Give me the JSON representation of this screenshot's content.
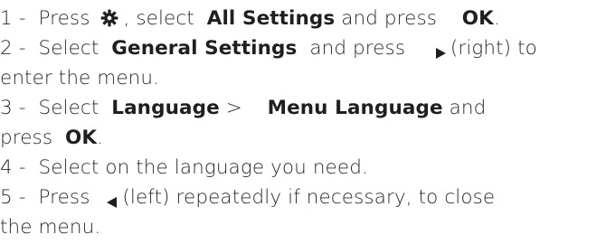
{
  "steps": [
    {
      "n": "1 -",
      "press": "Press",
      "icon": "gear-icon",
      "after_icon": ", select",
      "bold1": "All Settings",
      "and_press": "and press",
      "bold2": "OK",
      "end": "."
    },
    {
      "n": "2 -",
      "select": "Select",
      "bold1": "General Settings",
      "and_press": "and press",
      "icon": "triangle-right-icon",
      "after_icon": "(right) to",
      "cont": "enter the menu."
    },
    {
      "n": "3 -",
      "select": "Select",
      "bold1": "Language",
      "sep": ">",
      "bold2": "Menu Language",
      "and": "and",
      "press": "press",
      "bold3": "OK",
      "end": "."
    },
    {
      "n": "4 -",
      "text": "Select on the language you need."
    },
    {
      "n": "5 -",
      "press": "Press",
      "icon": "triangle-left-icon",
      "after_icon": "(left) repeatedly if necessary, to close",
      "cont": "the menu."
    }
  ],
  "colors": {
    "text": "#2a2a2a",
    "icon": "#1f1f1f"
  }
}
